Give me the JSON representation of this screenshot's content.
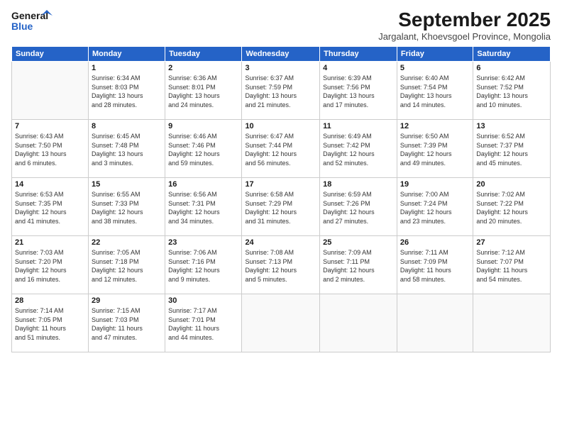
{
  "header": {
    "logo_line1": "General",
    "logo_line2": "Blue",
    "month": "September 2025",
    "location": "Jargalant, Khoevsgoel Province, Mongolia"
  },
  "weekdays": [
    "Sunday",
    "Monday",
    "Tuesday",
    "Wednesday",
    "Thursday",
    "Friday",
    "Saturday"
  ],
  "weeks": [
    [
      {
        "num": "",
        "info": ""
      },
      {
        "num": "1",
        "info": "Sunrise: 6:34 AM\nSunset: 8:03 PM\nDaylight: 13 hours\nand 28 minutes."
      },
      {
        "num": "2",
        "info": "Sunrise: 6:36 AM\nSunset: 8:01 PM\nDaylight: 13 hours\nand 24 minutes."
      },
      {
        "num": "3",
        "info": "Sunrise: 6:37 AM\nSunset: 7:59 PM\nDaylight: 13 hours\nand 21 minutes."
      },
      {
        "num": "4",
        "info": "Sunrise: 6:39 AM\nSunset: 7:56 PM\nDaylight: 13 hours\nand 17 minutes."
      },
      {
        "num": "5",
        "info": "Sunrise: 6:40 AM\nSunset: 7:54 PM\nDaylight: 13 hours\nand 14 minutes."
      },
      {
        "num": "6",
        "info": "Sunrise: 6:42 AM\nSunset: 7:52 PM\nDaylight: 13 hours\nand 10 minutes."
      }
    ],
    [
      {
        "num": "7",
        "info": "Sunrise: 6:43 AM\nSunset: 7:50 PM\nDaylight: 13 hours\nand 6 minutes."
      },
      {
        "num": "8",
        "info": "Sunrise: 6:45 AM\nSunset: 7:48 PM\nDaylight: 13 hours\nand 3 minutes."
      },
      {
        "num": "9",
        "info": "Sunrise: 6:46 AM\nSunset: 7:46 PM\nDaylight: 12 hours\nand 59 minutes."
      },
      {
        "num": "10",
        "info": "Sunrise: 6:47 AM\nSunset: 7:44 PM\nDaylight: 12 hours\nand 56 minutes."
      },
      {
        "num": "11",
        "info": "Sunrise: 6:49 AM\nSunset: 7:42 PM\nDaylight: 12 hours\nand 52 minutes."
      },
      {
        "num": "12",
        "info": "Sunrise: 6:50 AM\nSunset: 7:39 PM\nDaylight: 12 hours\nand 49 minutes."
      },
      {
        "num": "13",
        "info": "Sunrise: 6:52 AM\nSunset: 7:37 PM\nDaylight: 12 hours\nand 45 minutes."
      }
    ],
    [
      {
        "num": "14",
        "info": "Sunrise: 6:53 AM\nSunset: 7:35 PM\nDaylight: 12 hours\nand 41 minutes."
      },
      {
        "num": "15",
        "info": "Sunrise: 6:55 AM\nSunset: 7:33 PM\nDaylight: 12 hours\nand 38 minutes."
      },
      {
        "num": "16",
        "info": "Sunrise: 6:56 AM\nSunset: 7:31 PM\nDaylight: 12 hours\nand 34 minutes."
      },
      {
        "num": "17",
        "info": "Sunrise: 6:58 AM\nSunset: 7:29 PM\nDaylight: 12 hours\nand 31 minutes."
      },
      {
        "num": "18",
        "info": "Sunrise: 6:59 AM\nSunset: 7:26 PM\nDaylight: 12 hours\nand 27 minutes."
      },
      {
        "num": "19",
        "info": "Sunrise: 7:00 AM\nSunset: 7:24 PM\nDaylight: 12 hours\nand 23 minutes."
      },
      {
        "num": "20",
        "info": "Sunrise: 7:02 AM\nSunset: 7:22 PM\nDaylight: 12 hours\nand 20 minutes."
      }
    ],
    [
      {
        "num": "21",
        "info": "Sunrise: 7:03 AM\nSunset: 7:20 PM\nDaylight: 12 hours\nand 16 minutes."
      },
      {
        "num": "22",
        "info": "Sunrise: 7:05 AM\nSunset: 7:18 PM\nDaylight: 12 hours\nand 12 minutes."
      },
      {
        "num": "23",
        "info": "Sunrise: 7:06 AM\nSunset: 7:16 PM\nDaylight: 12 hours\nand 9 minutes."
      },
      {
        "num": "24",
        "info": "Sunrise: 7:08 AM\nSunset: 7:13 PM\nDaylight: 12 hours\nand 5 minutes."
      },
      {
        "num": "25",
        "info": "Sunrise: 7:09 AM\nSunset: 7:11 PM\nDaylight: 12 hours\nand 2 minutes."
      },
      {
        "num": "26",
        "info": "Sunrise: 7:11 AM\nSunset: 7:09 PM\nDaylight: 11 hours\nand 58 minutes."
      },
      {
        "num": "27",
        "info": "Sunrise: 7:12 AM\nSunset: 7:07 PM\nDaylight: 11 hours\nand 54 minutes."
      }
    ],
    [
      {
        "num": "28",
        "info": "Sunrise: 7:14 AM\nSunset: 7:05 PM\nDaylight: 11 hours\nand 51 minutes."
      },
      {
        "num": "29",
        "info": "Sunrise: 7:15 AM\nSunset: 7:03 PM\nDaylight: 11 hours\nand 47 minutes."
      },
      {
        "num": "30",
        "info": "Sunrise: 7:17 AM\nSunset: 7:01 PM\nDaylight: 11 hours\nand 44 minutes."
      },
      {
        "num": "",
        "info": ""
      },
      {
        "num": "",
        "info": ""
      },
      {
        "num": "",
        "info": ""
      },
      {
        "num": "",
        "info": ""
      }
    ]
  ]
}
